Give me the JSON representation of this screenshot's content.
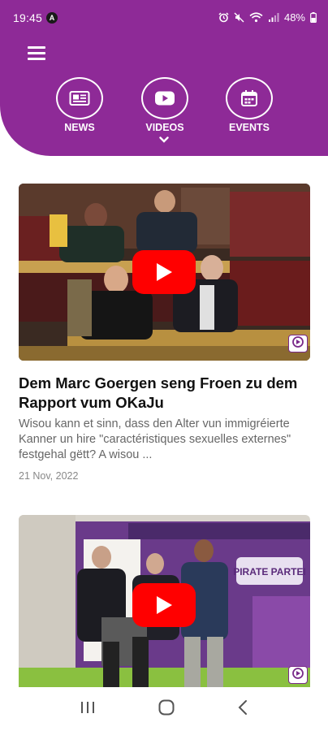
{
  "status_bar": {
    "time": "19:45",
    "a_badge": "A",
    "battery": "48%"
  },
  "colors": {
    "brand_purple": "#8e2a97",
    "play_red": "#ff0000"
  },
  "nav": {
    "items": [
      {
        "label": "NEWS",
        "icon": "newspaper-icon"
      },
      {
        "label": "VIDEOS",
        "icon": "youtube-icon",
        "selected": true
      },
      {
        "label": "EVENTS",
        "icon": "calendar-icon"
      }
    ]
  },
  "videos": [
    {
      "title": "Dem Marc Goergen seng Froen zu dem Rapport vum OKaJu",
      "excerpt": "Wisou kann et sinn, dass den Alter vun immigréierte Kanner un hire \"caractéristiques sexuelles externes\" festgehal gëtt? A wisou ...",
      "date": "21 Nov, 2022"
    },
    {
      "overlay_text": "PIRATE PARTEI"
    }
  ],
  "system_nav": {
    "recents": "recents-icon",
    "home": "home-icon",
    "back": "back-icon"
  }
}
